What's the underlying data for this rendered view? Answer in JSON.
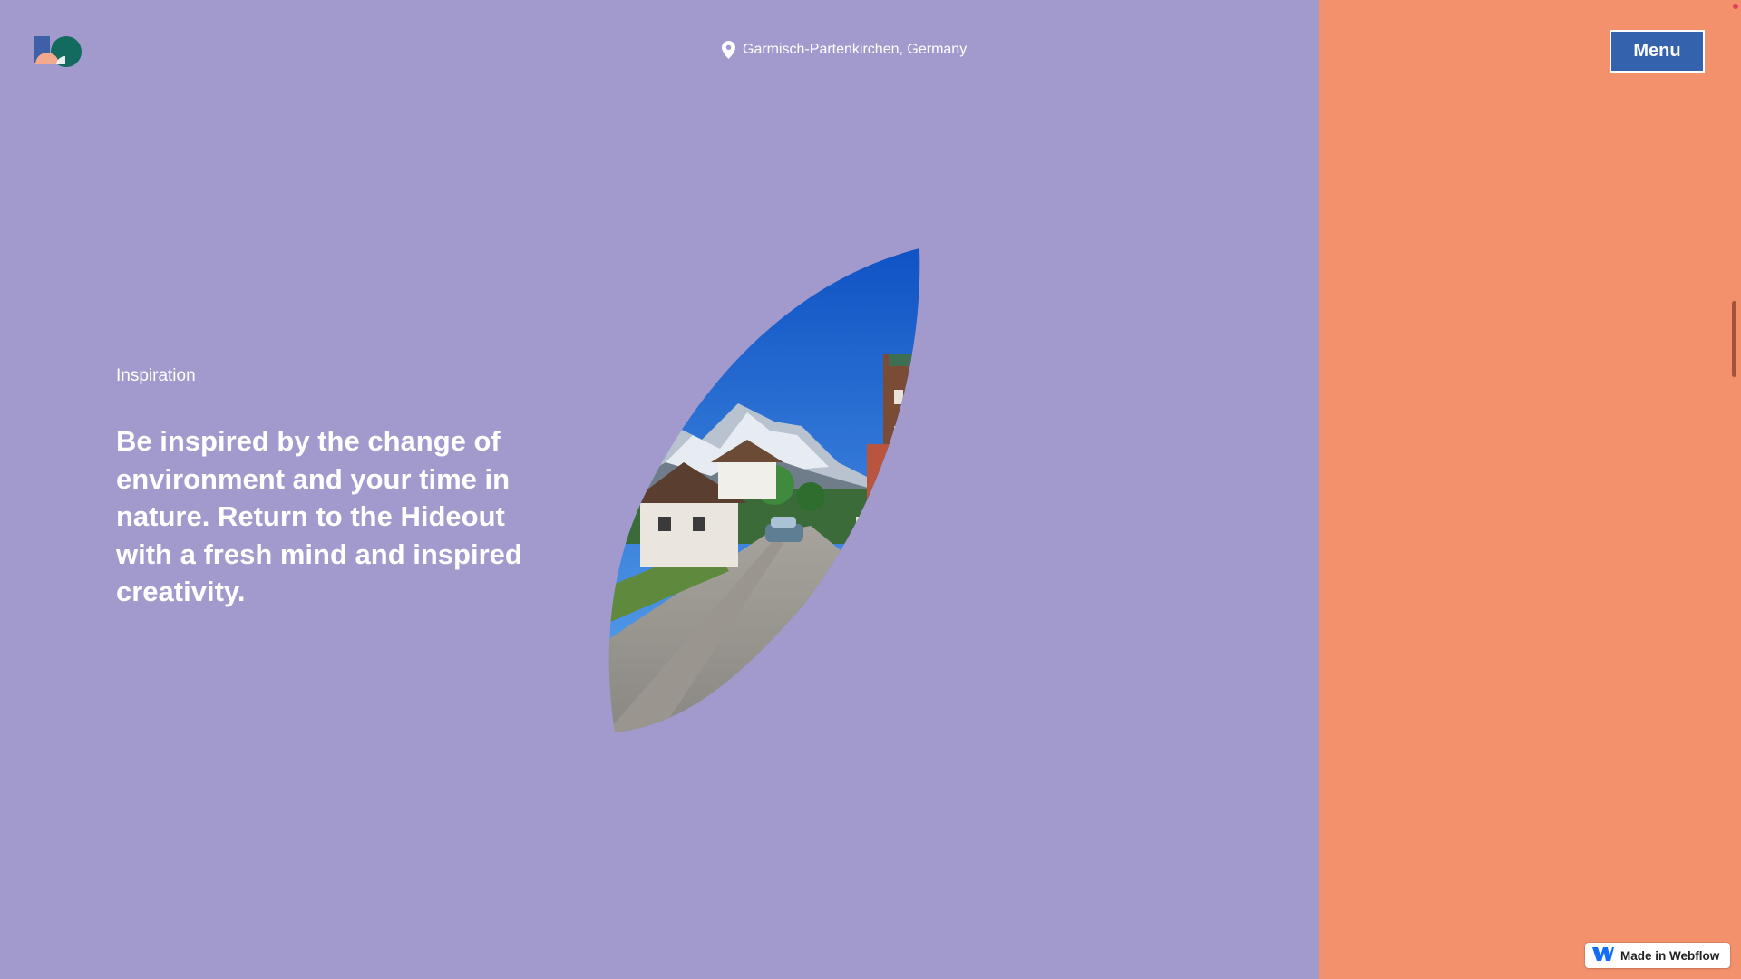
{
  "colors": {
    "left_background": "#a29acc",
    "right_background": "#f3916c",
    "menu_background": "#3562ad",
    "logo_blue": "#3f5fa8",
    "logo_teal": "#136a5f",
    "logo_peach": "#f2a98d",
    "sky": "#1a67d4",
    "scroll_indicator": "#a0553a",
    "corner_dot": "#e0405a",
    "webflow_blue": "#146ef5"
  },
  "header": {
    "logo_icon": "hideout-logo-icon",
    "location_icon": "map-pin-icon",
    "location": "Garmisch-Partenkirchen, Germany",
    "menu_label": "Menu"
  },
  "section": {
    "eyebrow": "Inspiration",
    "headline": "Be inspired by the change of environment and your time in nature. Return to the Hideout with a fresh mind and inspired creativity."
  },
  "badge": {
    "icon": "webflow-logo-icon",
    "label": "Made in Webflow"
  }
}
